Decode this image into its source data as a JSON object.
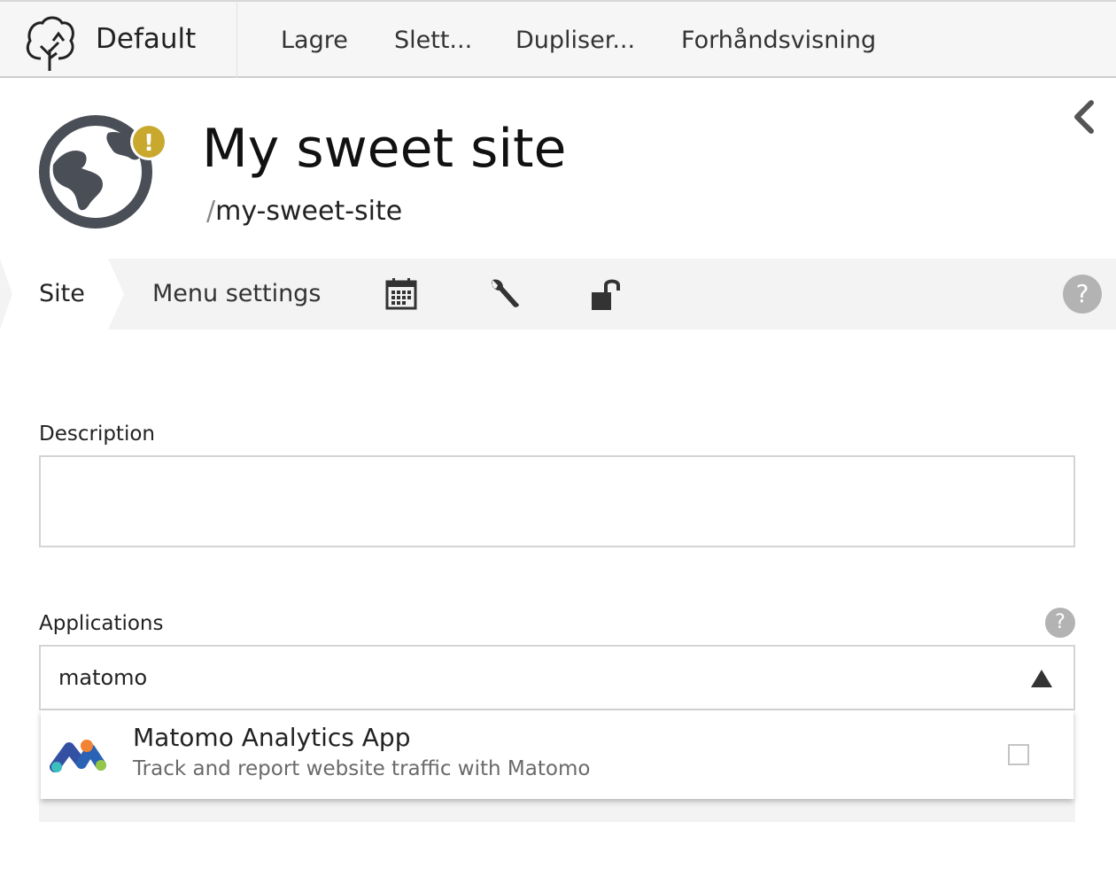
{
  "toolbar": {
    "home_title": "Default",
    "buttons": [
      "Lagre",
      "Slett...",
      "Dupliser...",
      "Forhåndsvisning"
    ]
  },
  "header": {
    "title": "My sweet site",
    "path_prefix": "/",
    "path_slug": "my-sweet-site",
    "status_badge": "!"
  },
  "tabs": {
    "site": "Site",
    "menu_settings": "Menu settings",
    "icons": [
      "calendar-icon",
      "wrench-icon",
      "unlock-icon"
    ],
    "help": "?"
  },
  "form": {
    "description_label": "Description",
    "description_value": "",
    "applications_label": "Applications",
    "applications_help": "?",
    "search_value": "matomo",
    "results": [
      {
        "name": "Matomo Analytics App",
        "description": "Track and report website traffic with Matomo",
        "checked": false
      }
    ]
  },
  "colors": {
    "badge": "#c9a92d",
    "globe": "#4a4e56",
    "help": "#b3b3b3"
  }
}
